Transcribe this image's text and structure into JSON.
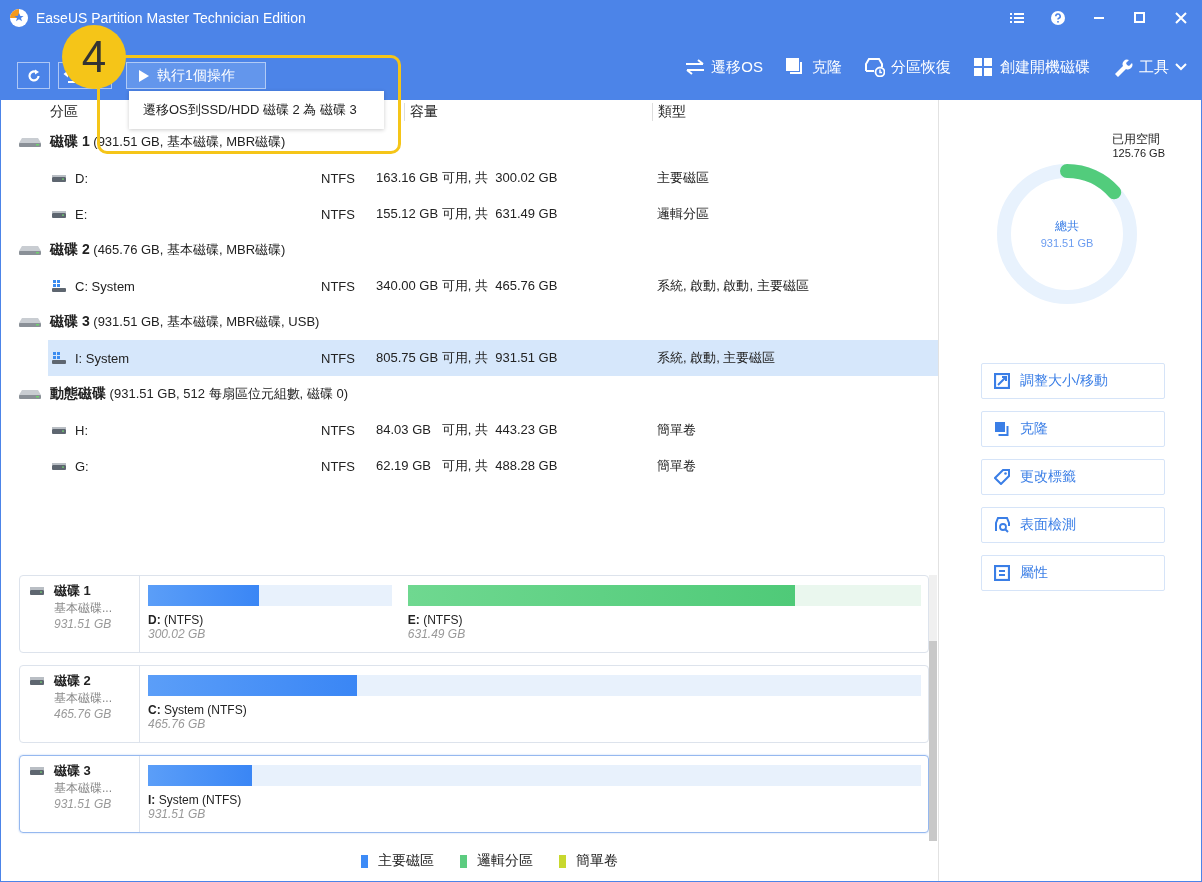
{
  "window": {
    "title": "EaseUS Partition Master Technician Edition"
  },
  "toolbar": {
    "execute_button": "執行1個操作",
    "pending_menu": [
      "遷移OS到SSD/HDD 磁碟 2 為 磁碟 3"
    ],
    "actions": [
      {
        "label": "遷移OS",
        "kind": "migrate"
      },
      {
        "label": "克隆",
        "kind": "clone"
      },
      {
        "label": "分區恢復",
        "kind": "recover"
      },
      {
        "label": "創建開機磁碟",
        "kind": "bootdisk"
      },
      {
        "label": "工具",
        "kind": "tools"
      }
    ]
  },
  "callout": {
    "number": "4"
  },
  "table": {
    "columns": [
      "分區",
      "容量",
      "類型"
    ],
    "groups": [
      {
        "label": "**磁碟 1** (931.51 GB, 基本磁碟, MBR磁碟)",
        "partitions": [
          {
            "name": "D:",
            "kind": "drive",
            "fs": "NTFS",
            "capacity": "163.16 GB 可用, 共  300.02 GB",
            "type": "主要磁區",
            "selected": false
          },
          {
            "name": "E:",
            "kind": "drive",
            "fs": "NTFS",
            "capacity": "155.12 GB 可用, 共  631.49 GB",
            "type": "邏輯分區",
            "selected": false
          }
        ]
      },
      {
        "label": "**磁碟 2** (465.76 GB, 基本磁碟, MBR磁碟)",
        "partitions": [
          {
            "name": "C: System",
            "kind": "system",
            "fs": "NTFS",
            "capacity": "340.00 GB 可用, 共  465.76 GB",
            "type": "系統, 啟動, 啟動, 主要磁區",
            "selected": false
          }
        ]
      },
      {
        "label": "**磁碟 3** (931.51 GB, 基本磁碟, MBR磁碟, USB)",
        "partitions": [
          {
            "name": "I: System",
            "kind": "system",
            "fs": "NTFS",
            "capacity": "805.75 GB 可用, 共  931.51 GB",
            "type": "系統, 啟動, 主要磁區",
            "selected": true
          }
        ]
      },
      {
        "label": "**動態磁碟** (931.51 GB, 512 每扇區位元組數, 磁碟 0)",
        "partitions": [
          {
            "name": "H:",
            "kind": "drive",
            "fs": "NTFS",
            "capacity": "84.03 GB   可用, 共  443.23 GB",
            "type": "簡單卷",
            "selected": false
          },
          {
            "name": "G:",
            "kind": "drive",
            "fs": "NTFS",
            "capacity": "62.19 GB   可用, 共  488.28 GB",
            "type": "簡單卷",
            "selected": false
          }
        ]
      }
    ]
  },
  "disk_map": [
    {
      "name": "磁碟 1",
      "subtitle": "基本磁碟...",
      "size": "931.51 GB",
      "selected": false,
      "partitions": [
        {
          "label": "**D:**  (NTFS)",
          "size": "300.02 GB",
          "kind": "primary",
          "level": 0.456
        },
        {
          "label": "**E:**  (NTFS)",
          "size": "631.49 GB",
          "kind": "logical",
          "level": 0.754
        }
      ]
    },
    {
      "name": "磁碟 2",
      "subtitle": "基本磁碟...",
      "size": "465.76 GB",
      "selected": false,
      "partitions": [
        {
          "label": "**C:** System (NTFS)",
          "size": "465.76 GB",
          "kind": "primary",
          "level": 0.27
        }
      ]
    },
    {
      "name": "磁碟 3",
      "subtitle": "基本磁碟...",
      "size": "931.51 GB",
      "selected": true,
      "partitions": [
        {
          "label": "**I:** System (NTFS)",
          "size": "931.51 GB",
          "kind": "primary",
          "level": 0.135
        }
      ]
    }
  ],
  "legend": [
    {
      "label": "主要磁區",
      "color": "#3d8bf7"
    },
    {
      "label": "邏輯分區",
      "color": "#5ccc80"
    },
    {
      "label": "簡單卷",
      "color": "#c8d82e"
    }
  ],
  "usage": {
    "used_label": "已用空間",
    "used_value": "125.76 GB",
    "total_label": "總共",
    "total_value": "931.51 GB"
  },
  "side_actions": [
    {
      "label": "調整大小/移動",
      "kind": "resize"
    },
    {
      "label": "克隆",
      "kind": "clone"
    },
    {
      "label": "更改標籤",
      "kind": "label"
    },
    {
      "label": "表面檢測",
      "kind": "surface"
    },
    {
      "label": "屬性",
      "kind": "properties"
    }
  ]
}
